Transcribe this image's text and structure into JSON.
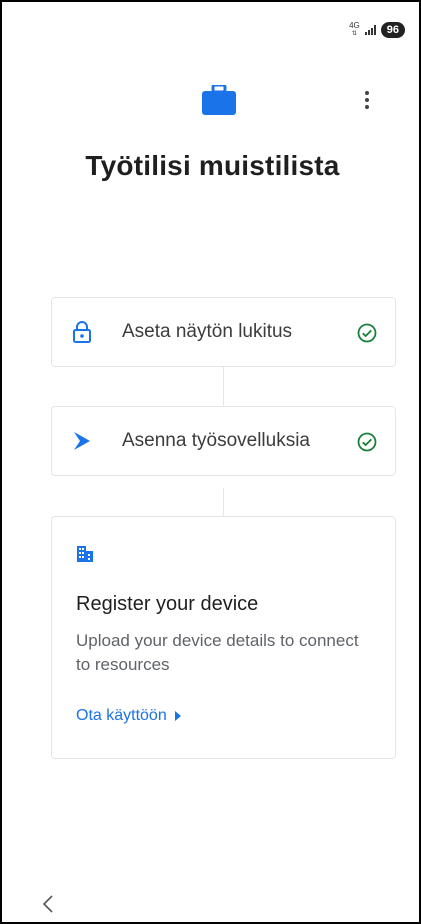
{
  "status": {
    "network": "4G",
    "battery": "96"
  },
  "header": {
    "title": "Työtilisi muistilista"
  },
  "steps": [
    {
      "label": "Aseta näytön lukitus",
      "icon": "lock-icon",
      "status": "done"
    },
    {
      "label": "Asenna työsovelluksia",
      "icon": "play-store-icon",
      "status": "done"
    }
  ],
  "register": {
    "icon": "building-icon",
    "title": "Register your device",
    "description": "Upload your device details to connect to resources",
    "action_label": "Ota käyttöön"
  },
  "colors": {
    "accent": "#1a73e8",
    "success": "#188038"
  }
}
